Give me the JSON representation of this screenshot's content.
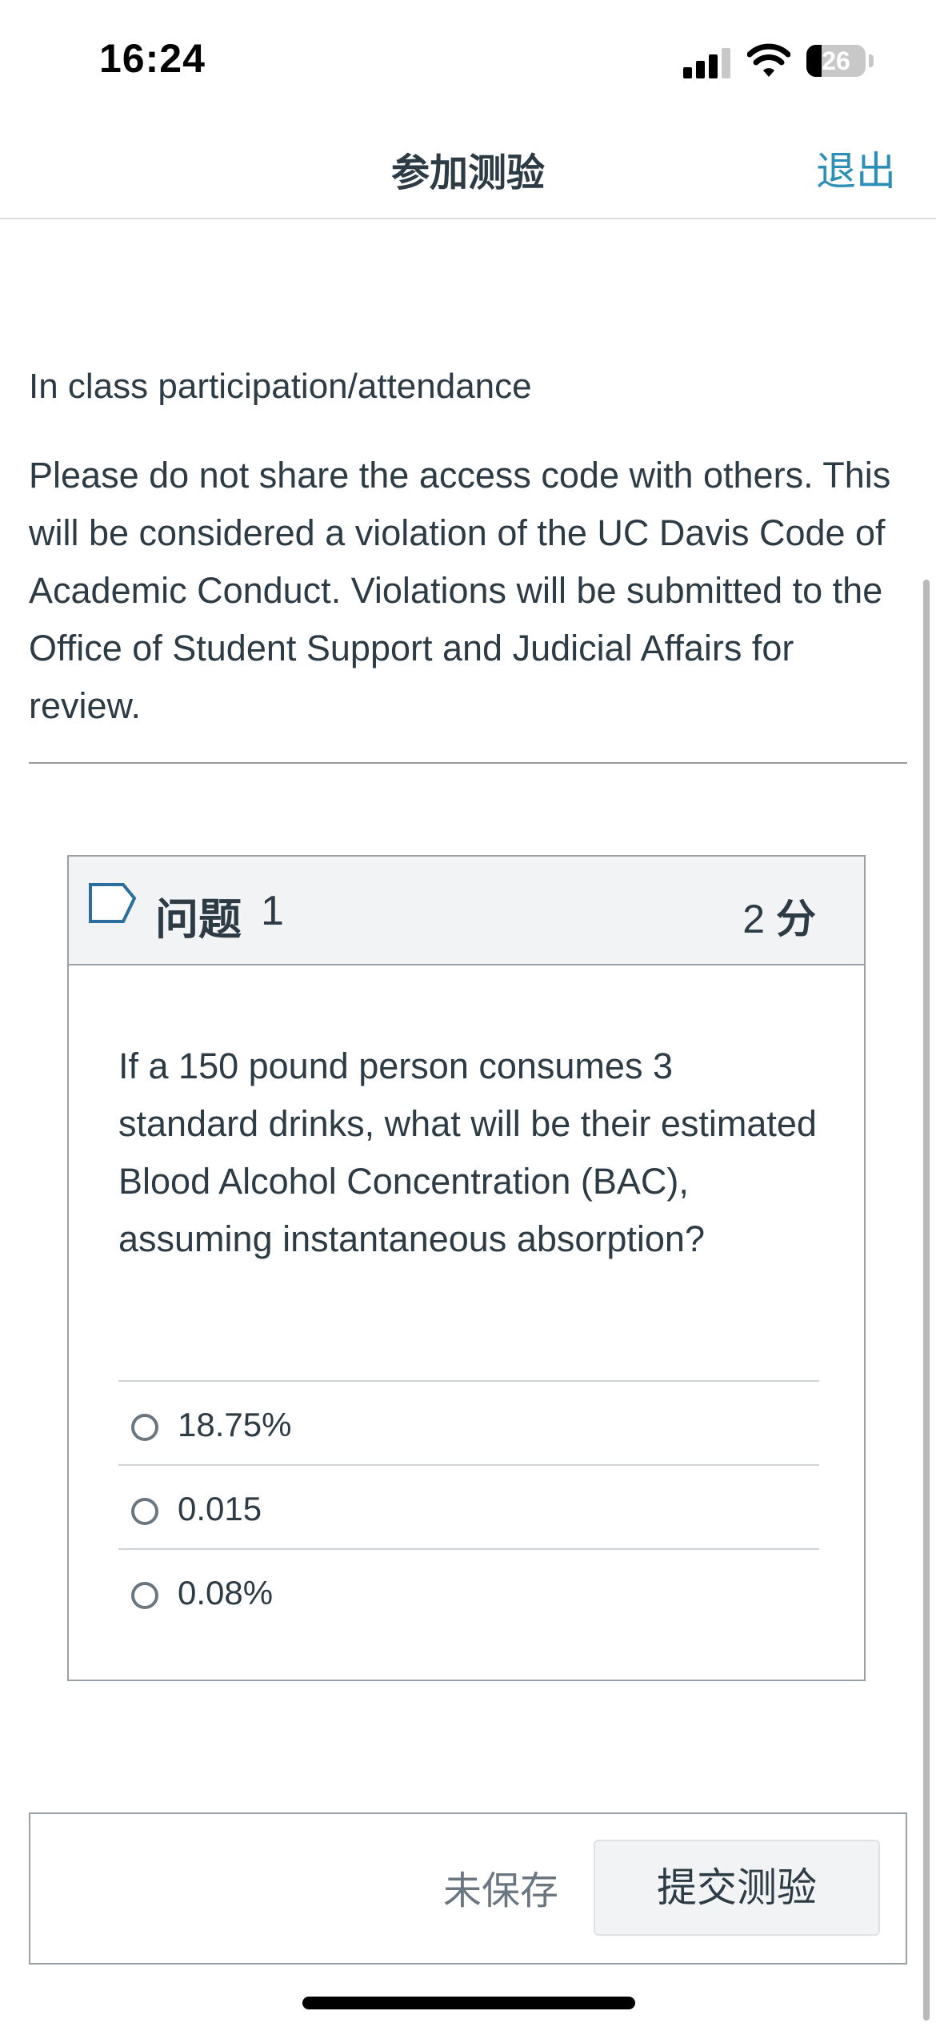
{
  "status_bar": {
    "time": "16:24",
    "battery_level": "26",
    "battery_fraction": 0.26,
    "icons": [
      "cellular-signal-icon",
      "wifi-icon",
      "battery-icon"
    ]
  },
  "nav": {
    "title": "参加测验",
    "exit_label": "退出"
  },
  "quiz": {
    "title": "In class participation/attendance",
    "description": "Please do not share the access code with others. This will be considered a violation of the UC Davis Code of Academic Conduct. Violations will be submitted to the Office of Student Support and Judicial Affairs for review."
  },
  "question": {
    "label": "问题",
    "number": "1",
    "points_value": "2",
    "points_unit": "分",
    "text": "If a 150 pound person consumes 3 standard drinks, what will be their estimated Blood Alcohol Concentration (BAC), assuming instantaneous absorption?",
    "answers": [
      {
        "label": "18.75%",
        "selected": false
      },
      {
        "label": "0.015",
        "selected": false
      },
      {
        "label": "0.08%",
        "selected": false
      }
    ]
  },
  "footer": {
    "status": "未保存",
    "submit_label": "提交测验"
  },
  "colors": {
    "accent": "#2b8fb8",
    "text": "#2d3b45",
    "muted": "#6b7780",
    "header_bg": "#f2f3f4"
  }
}
